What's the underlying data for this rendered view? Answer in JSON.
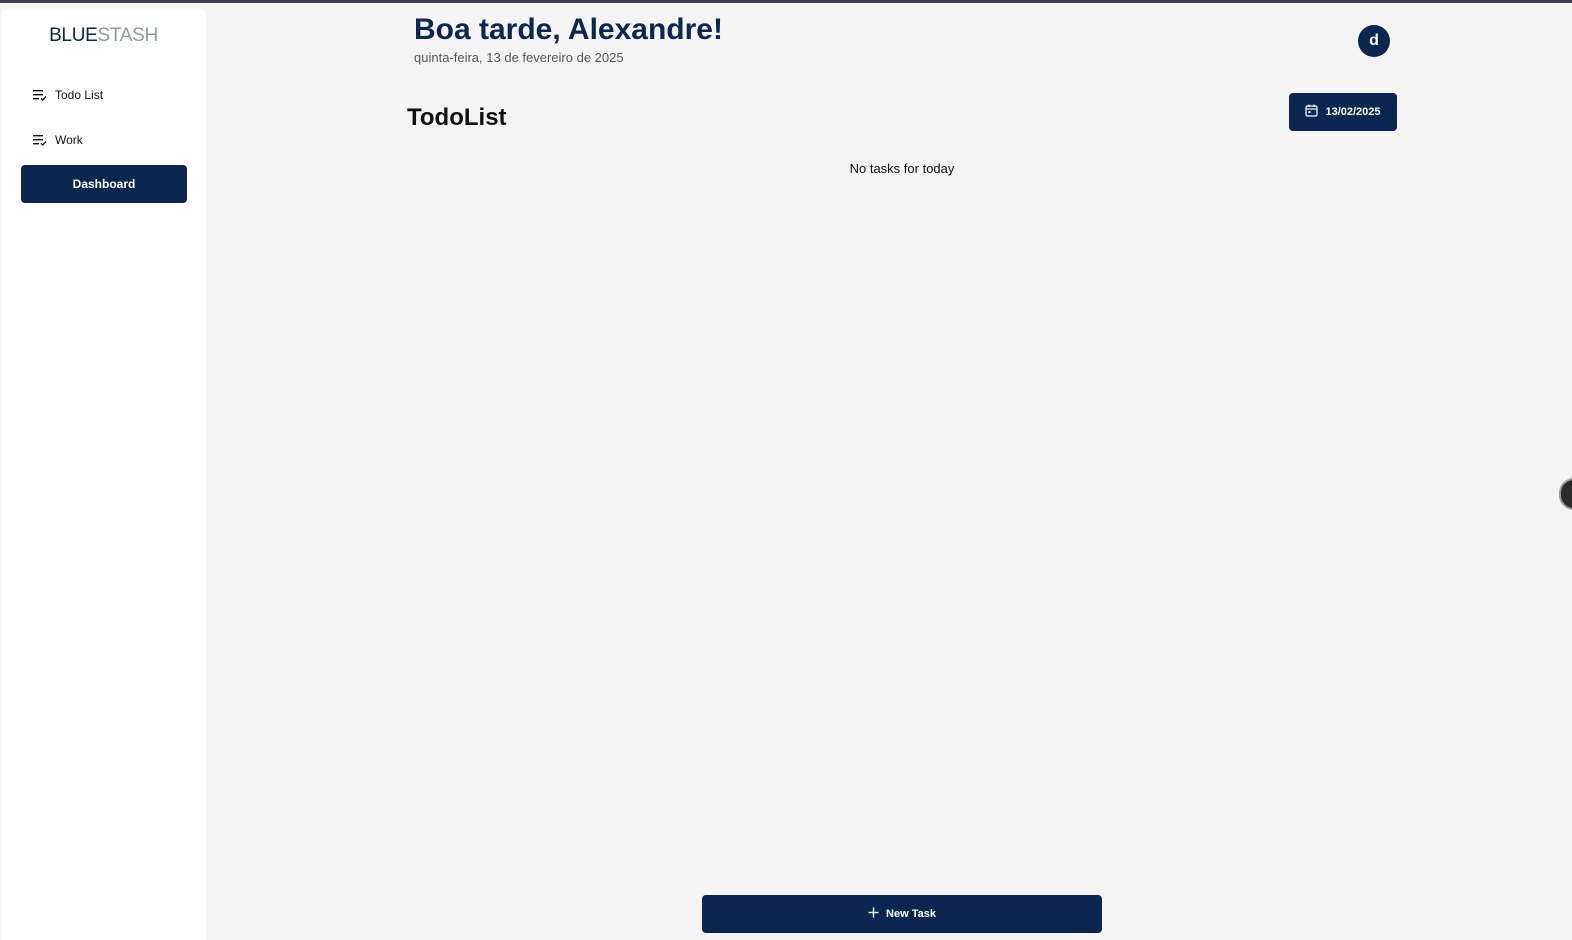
{
  "brand": {
    "part1": "BLUE",
    "part2": "STASH"
  },
  "sidebar": {
    "items": [
      {
        "label": "Todo List",
        "icon": "list-check-icon"
      },
      {
        "label": "Work",
        "icon": "list-check-icon"
      },
      {
        "label": "Dashboard",
        "active": true
      }
    ]
  },
  "header": {
    "greeting": "Boa tarde, Alexandre!",
    "date_text": "quinta-feira, 13 de fevereiro de 2025",
    "avatar_initial": "d"
  },
  "main": {
    "title": "TodoList",
    "date_button_label": "13/02/2025",
    "empty_message": "No tasks for today",
    "new_task_label": "New Task"
  },
  "colors": {
    "primary": "#0b2650",
    "background": "#f4f4f4",
    "sidebar": "#ffffff"
  }
}
